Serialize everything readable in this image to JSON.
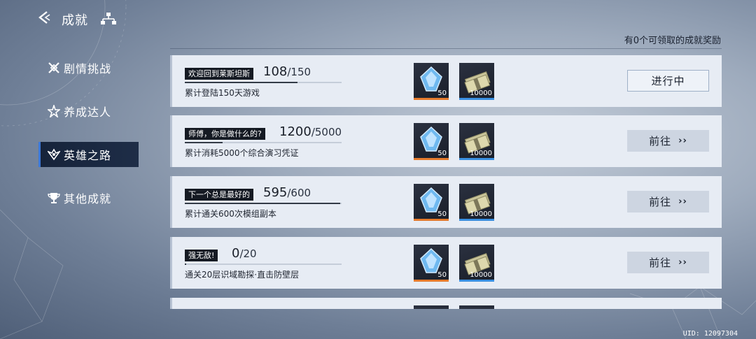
{
  "header": {
    "title": "成就",
    "claimable_text": "有0个可领取的成就奖励"
  },
  "sidebar": {
    "items": [
      {
        "label": "剧情挑战",
        "icon": "crossed-swords-icon",
        "active": false
      },
      {
        "label": "养成达人",
        "icon": "star-flourish-icon",
        "active": false
      },
      {
        "label": "英雄之路",
        "icon": "hero-emblem-icon",
        "active": true
      },
      {
        "label": "其他成就",
        "icon": "trophy-icon",
        "active": false
      }
    ]
  },
  "achievements": [
    {
      "name": "欢迎回到莱斯坦斯",
      "current": "108",
      "total": "/150",
      "progress": 0.72,
      "desc": "累计登陆150天游戏",
      "rewards": [
        {
          "icon": "crystal-icon",
          "count": "50"
        },
        {
          "icon": "cash-stack-icon",
          "count": "10000"
        }
      ],
      "button": "进行中",
      "button_type": "inprogress"
    },
    {
      "name": "师傅，你是做什么的?",
      "current": "1200",
      "total": "/5000",
      "progress": 0.24,
      "desc": "累计消耗5000个综合演习凭证",
      "rewards": [
        {
          "icon": "crystal-icon",
          "count": "50"
        },
        {
          "icon": "cash-stack-icon",
          "count": "10000"
        }
      ],
      "button": "前往",
      "button_type": "goto"
    },
    {
      "name": "下一个总是最好的",
      "current": "595",
      "total": "/600",
      "progress": 0.99,
      "desc": "累计通关600次模组副本",
      "rewards": [
        {
          "icon": "crystal-icon",
          "count": "50"
        },
        {
          "icon": "cash-stack-icon",
          "count": "10000"
        }
      ],
      "button": "前往",
      "button_type": "goto"
    },
    {
      "name": "强无敌!",
      "current": "0",
      "total": "/20",
      "progress": 0.0,
      "desc": "通关20层识域勘探·直击防壁层",
      "rewards": [
        {
          "icon": "crystal-icon",
          "count": "50"
        },
        {
          "icon": "cash-stack-icon",
          "count": "10000"
        }
      ],
      "button": "前往",
      "button_type": "goto"
    }
  ],
  "button_chevron": "››",
  "uid": "UID: 12097304",
  "colors": {
    "active_tab_bg": "#16233a",
    "active_tab_accent": "#3b78d8",
    "card_bg": "#e7ecf4",
    "crystal_strip": "#e47a2c",
    "cash_strip": "#3a8fe0"
  }
}
